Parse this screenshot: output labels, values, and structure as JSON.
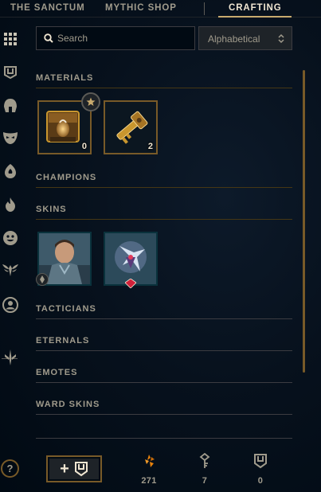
{
  "nav": {
    "tabs": [
      {
        "label": "THE SANCTUM"
      },
      {
        "label": "MYTHIC SHOP"
      },
      {
        "label": "CRAFTING"
      }
    ],
    "active_tab": "CRAFTING"
  },
  "sidebar": {
    "icons": [
      "grid-icon",
      "chest-icon",
      "helmet-icon",
      "mask-icon",
      "ward-icon",
      "flame-icon",
      "emote-icon",
      "winged-icon",
      "profile-icon",
      "sword-icon"
    ]
  },
  "search": {
    "placeholder": "Search",
    "value": ""
  },
  "sort": {
    "selected": "Alphabetical"
  },
  "sections": {
    "materials": "MATERIALS",
    "champions": "CHAMPIONS",
    "skins": "SKINS",
    "tacticians": "TACTICIANS",
    "eternals": "ETERNALS",
    "emotes": "EMOTES",
    "ward_skins": "WARD SKINS"
  },
  "materials": [
    {
      "name": "mastercraft-chest",
      "count": "0"
    },
    {
      "name": "hextech-key",
      "count": "2"
    }
  ],
  "skins": [
    {
      "name": "champion-skin-1"
    },
    {
      "name": "champion-skin-2"
    }
  ],
  "bottom": {
    "currencies": [
      {
        "icon": "orange-essence-icon",
        "value": "271"
      },
      {
        "icon": "key-fragment-icon",
        "value": "7"
      },
      {
        "icon": "chest-count-icon",
        "value": "0"
      }
    ]
  },
  "colors": {
    "gold": "#c8aa6e",
    "gold_dark": "#785a28",
    "text": "#a09b8c",
    "orange": "#e8820c"
  }
}
